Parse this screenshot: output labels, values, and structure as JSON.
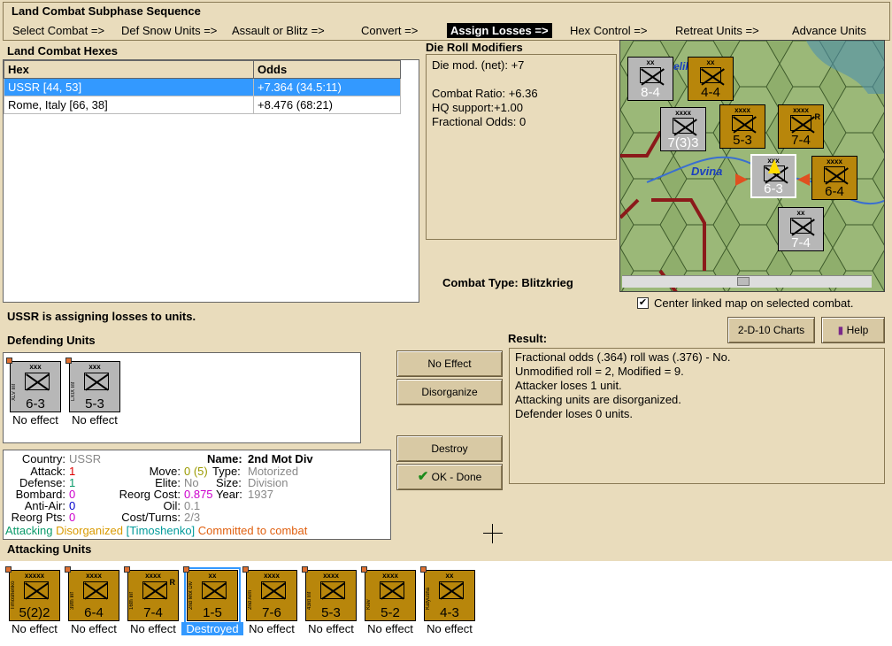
{
  "phase": {
    "title": "Land Combat Subphase Sequence",
    "steps": [
      "Select Combat =>",
      "Def Snow Units =>",
      "Assault or Blitz =>",
      "Convert =>",
      "Assign Losses =>",
      "Hex Control =>",
      "Retreat Units =>",
      "Advance Units"
    ],
    "active_index": 4
  },
  "hexes": {
    "title": "Land Combat Hexes",
    "columns": [
      "Hex",
      "Odds"
    ],
    "rows": [
      {
        "hex": "USSR [44, 53]",
        "odds": "+7.364 (34.5:11)"
      },
      {
        "hex": "Rome, Italy [66, 38]",
        "odds": "+8.476 (68:21)"
      }
    ]
  },
  "drm": {
    "title": "Die Roll Modifiers",
    "lines": [
      "Die mod. (net): +7",
      "",
      "Combat Ratio: +6.36",
      "HQ support:+1.00",
      "Fractional Odds: 0"
    ]
  },
  "combat_type": {
    "label": "Combat Type:",
    "value": "Blitzkrieg"
  },
  "map": {
    "labels": [
      "Dvina",
      "elik"
    ],
    "center_check_label": "Center linked map on selected combat.",
    "counters": [
      {
        "size": "xx",
        "side": "V Inf",
        "val": "8-4",
        "nat": "ussr"
      },
      {
        "size": "xx",
        "side": "12th Inf",
        "val": "4-4",
        "nat": "us"
      },
      {
        "size": "xxxx",
        "side": "",
        "val": "7(3)3",
        "nat": "ussr"
      },
      {
        "size": "xxxx",
        "side": "4th Inf",
        "val": "5-3",
        "nat": "us"
      },
      {
        "size": "xxxx",
        "side": "1st Inf",
        "val": "7-4",
        "nat": "us",
        "r": "R"
      },
      {
        "size": "xxx",
        "side": "XLV Inf",
        "val": "6-3",
        "nat": "ussr"
      },
      {
        "size": "xxxx",
        "side": "",
        "val": "6-4",
        "nat": "us"
      },
      {
        "size": "xx",
        "side": "XXV Inf",
        "val": "7-4",
        "nat": "ussr"
      }
    ]
  },
  "status": "USSR is assigning losses to units.",
  "defending": {
    "title": "Defending Units",
    "units": [
      {
        "size": "xxx",
        "side": "XLV Inf",
        "val": "6-3",
        "caption": "No effect"
      },
      {
        "size": "xxx",
        "side": "LXIX Inf",
        "val": "5-3",
        "caption": "No effect"
      }
    ]
  },
  "buttons": {
    "no_effect": "No Effect",
    "disorganize": "Disorganize",
    "destroy": "Destroy",
    "ok_done": "OK - Done",
    "charts": "2-D-10 Charts",
    "help": "Help"
  },
  "result": {
    "title": "Result:",
    "lines": [
      "Fractional odds (.364) roll was (.376)  - No.",
      "Unmodified roll = 2, Modified = 9.",
      "Attacker loses 1 unit.",
      "Attacking units are disorganized.",
      "Defender loses 0 units."
    ]
  },
  "info": {
    "country_label": "Country:",
    "country": "USSR",
    "attack_label": "Attack:",
    "attack": "1",
    "defense_label": "Defense:",
    "defense": "1",
    "bombard_label": "Bombard:",
    "bombard": "0",
    "antiair_label": "Anti-Air:",
    "antiair": "0",
    "reorg_label": "Reorg Pts:",
    "reorg": "0",
    "name_label": "Name:",
    "name": "2nd Mot Div",
    "move_label": "Move:",
    "move": "0 (5)",
    "elite_label": "Elite:",
    "elite": "No",
    "reorgcost_label": "Reorg Cost:",
    "reorgcost": "0.875",
    "oil_label": "Oil:",
    "oil": "0.1",
    "cost_label": "Cost/Turns:",
    "cost": "2/3",
    "type_label": "Type:",
    "type": "Motorized",
    "size_label": "Size:",
    "size": "Division",
    "year_label": "Year:",
    "year": "1937",
    "status_attacking": "Attacking",
    "status_disorg": "Disorganized",
    "status_hq": "[Timoshenko]",
    "status_committed": "Committed to combat"
  },
  "attacking": {
    "title": "Attacking Units",
    "units": [
      {
        "size": "xxxxx",
        "side": "Timoshenko",
        "val": "5(2)2",
        "caption": "No effect",
        "r": ""
      },
      {
        "size": "xxxx",
        "side": "39th Inf",
        "val": "6-4",
        "caption": "No effect",
        "r": ""
      },
      {
        "size": "xxxx",
        "side": "16th Inf",
        "val": "7-4",
        "caption": "No effect",
        "r": "R"
      },
      {
        "size": "xx",
        "side": "2nd Mot Div",
        "val": "1-5",
        "caption": "Destroyed",
        "r": ""
      },
      {
        "size": "xxxx",
        "side": "2nd Arm",
        "val": "7-6",
        "caption": "No effect",
        "r": ""
      },
      {
        "size": "xxxx",
        "side": "43rd Inf",
        "val": "5-3",
        "caption": "No effect",
        "r": ""
      },
      {
        "size": "xxxx",
        "side": "Kiev",
        "val": "5-2",
        "caption": "No effect",
        "r": ""
      },
      {
        "size": "xx",
        "side": "Katyusha",
        "val": "4-3",
        "caption": "No effect",
        "r": ""
      }
    ]
  },
  "colors": {
    "bg": "#e9dcbc",
    "us_counter": "#b8860b",
    "ussr_counter": "#b7b7b7",
    "select": "#3399ff",
    "attack_green": "#0a9a6a",
    "disorg_orange": "#d99a00",
    "hq_teal": "#009a9a",
    "committed": "#e06010"
  }
}
